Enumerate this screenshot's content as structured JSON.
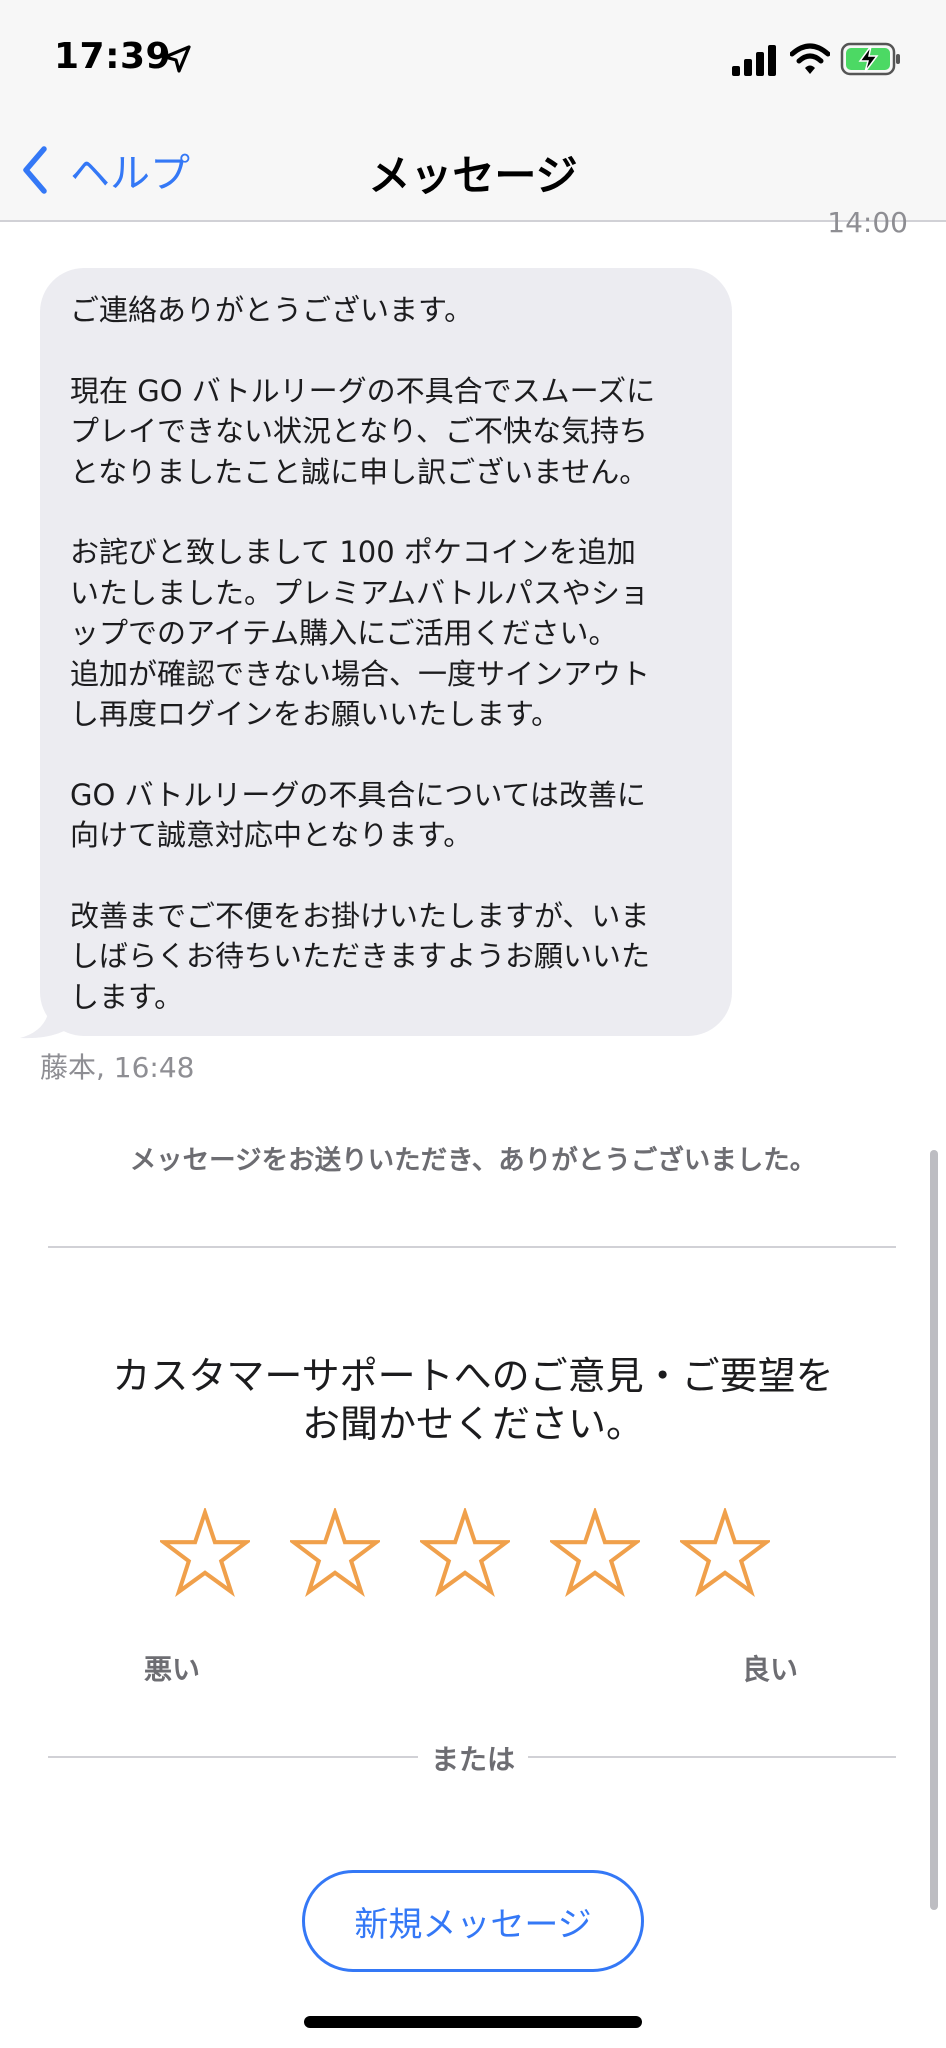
{
  "status_bar": {
    "time": "17:39",
    "icons": [
      "location-arrow-icon",
      "cellular-signal-icon",
      "wifi-icon",
      "battery-charging-icon"
    ],
    "battery_color": "#4cd964"
  },
  "nav": {
    "back_label": "ヘルプ",
    "title": "メッセージ"
  },
  "conversation": {
    "partial_timestamp": "14:00",
    "message": {
      "paragraphs": [
        "ご連絡ありがとうございます。",
        "現在 GO バトルリーグの不具合でスムーズに\nプレイできない状況となり、ご不快な気持ち\nとなりましたこと誠に申し訳ございません。",
        "お詫びと致しまして 100 ポケコインを追加\nいたしました。プレミアムバトルパスやショ\nップでのアイテム購入にご活用ください。\n追加が確認できない場合、一度サインアウト\nし再度ログインをお願いいたします。",
        "GO バトルリーグの不具合については改善に\n向けて誠意対応中となります。",
        "改善までご不便をお掛けいたしますが、いま\nしばらくお待ちいただきますようお願いいた\nします。"
      ],
      "meta": "藤本, 16:48"
    }
  },
  "thanks_text": "メッセージをお送りいただき、ありがとうございました。",
  "feedback": {
    "title_line1": "カスタマーサポートへのご意見・ご要望を",
    "title_line2": "お聞かせください。",
    "rating": {
      "selected": 0,
      "max": 5,
      "star_color": "#f0a04b"
    },
    "low_label": "悪い",
    "high_label": "良い"
  },
  "or_label": "または",
  "new_message_button": "新規メッセージ",
  "colors": {
    "accent": "#3478f6",
    "bubble": "#ececf1"
  }
}
